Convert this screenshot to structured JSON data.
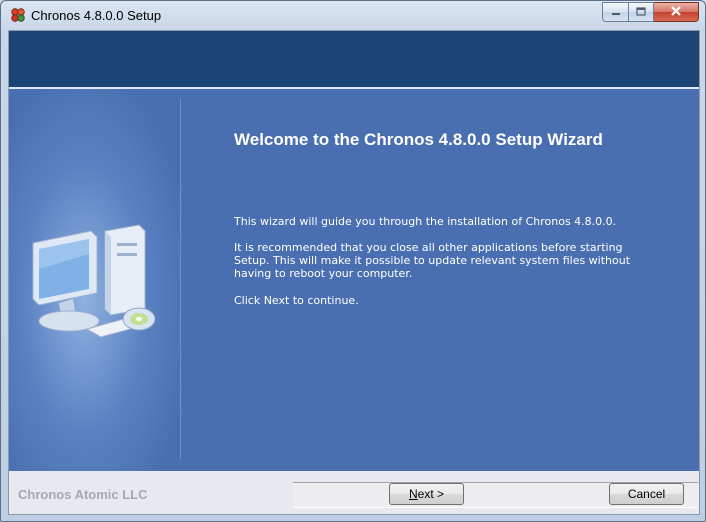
{
  "window": {
    "title": "Chronos 4.8.0.0 Setup",
    "app_icon": "installer-icon"
  },
  "caption_buttons": [
    "minimize-icon",
    "maximize-icon",
    "close-icon"
  ],
  "welcome": {
    "heading": "Welcome to the Chronos 4.8.0.0 Setup Wizard",
    "paragraph1": "This wizard will guide you through the installation of Chronos 4.8.0.0.",
    "paragraph2": "It is recommended that you close all other applications before starting Setup. This will make it possible to update relevant system files without having to reboot your computer.",
    "paragraph3": "Click Next to continue.",
    "illustration": "computer-icon"
  },
  "footer": {
    "brand": "Chronos Atomic LLC",
    "next_label": "Next >",
    "cancel_label": "Cancel"
  },
  "colors": {
    "header_band": "#1c4576",
    "panel": "#4a6fb0",
    "text": "#ffffff"
  }
}
